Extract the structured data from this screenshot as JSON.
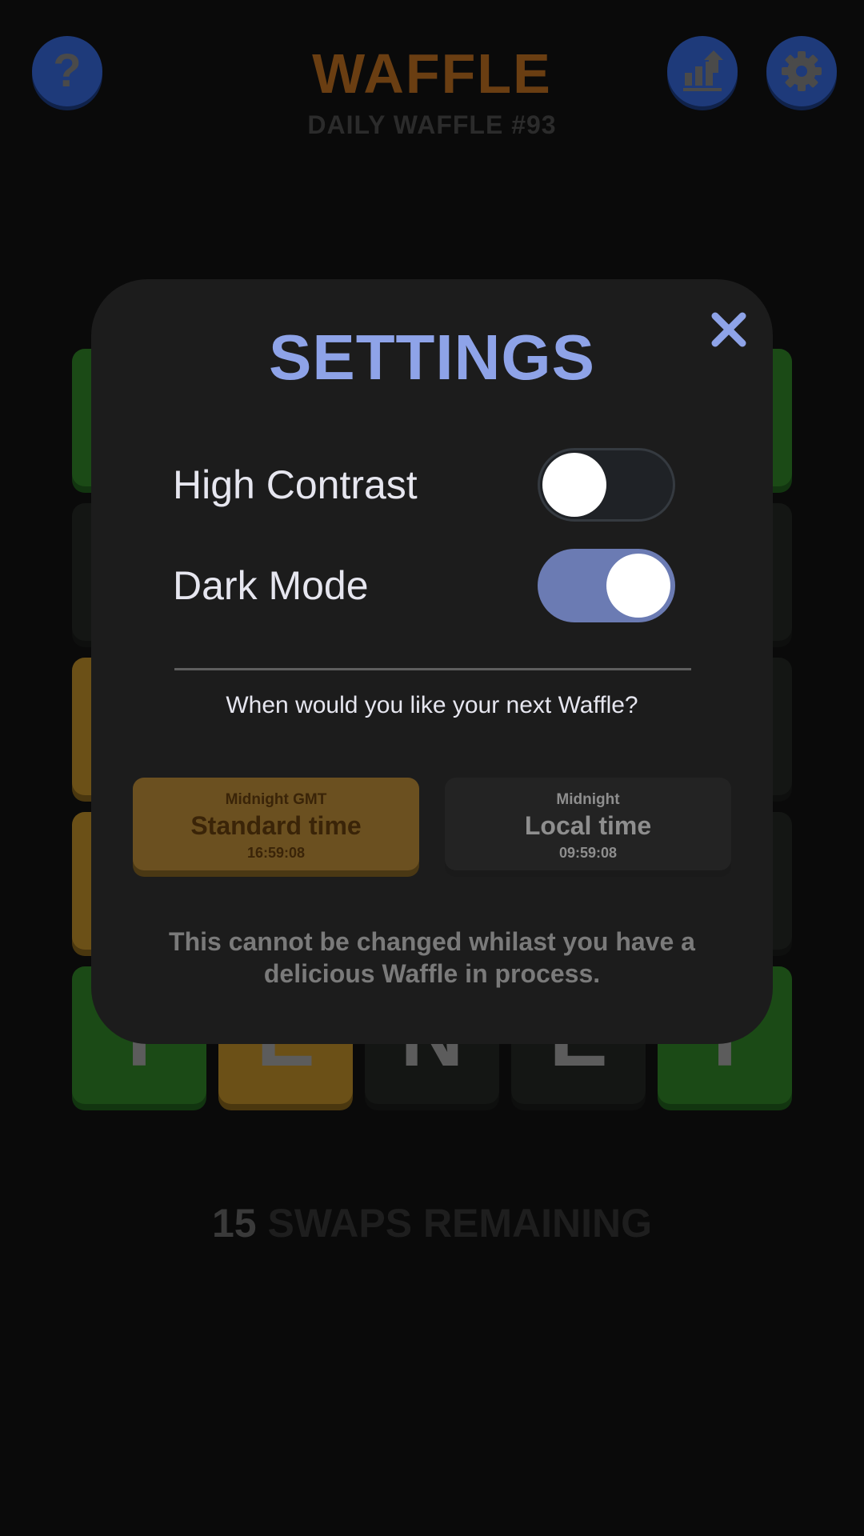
{
  "header": {
    "title": "WAFFLE",
    "subtitle": "DAILY WAFFLE #93",
    "help_glyph": "?",
    "icons": [
      "help-icon",
      "stats-icon",
      "gear-icon"
    ]
  },
  "board": {
    "tiles": [
      {
        "letter": "",
        "color": "green"
      },
      {
        "letter": "",
        "color": "green"
      },
      {
        "letter": "",
        "color": "gray"
      },
      {
        "letter": "",
        "color": "gray"
      },
      {
        "letter": "",
        "color": "yellow"
      },
      {
        "letter": "",
        "color": "gray"
      },
      {
        "letter": "",
        "color": "yellow"
      },
      {
        "letter": "",
        "color": "gray"
      },
      {
        "letter": "T",
        "color": "green"
      },
      {
        "letter": "E",
        "color": "yellow"
      },
      {
        "letter": "N",
        "color": "gray"
      },
      {
        "letter": "E",
        "color": "gray"
      },
      {
        "letter": "T",
        "color": "green"
      }
    ]
  },
  "footer": {
    "swaps_count": "15",
    "swaps_label": "SWAPS REMAINING"
  },
  "settings": {
    "title": "SETTINGS",
    "close_icon": "close-icon",
    "high_contrast": {
      "label": "High Contrast",
      "enabled": false
    },
    "dark_mode": {
      "label": "Dark Mode",
      "enabled": true
    },
    "next_question": "When would you like your next Waffle?",
    "standard": {
      "small": "Midnight GMT",
      "big": "Standard time",
      "clock": "16:59:08",
      "selected": true
    },
    "local": {
      "small": "Midnight",
      "big": "Local time",
      "clock": "09:59:08",
      "selected": false
    },
    "notice": "This cannot be changed whilast you have a delicious Waffle in process."
  },
  "colors": {
    "accent": "#8ea3e8",
    "toggle_on": "#6b7bb3",
    "standard_option": "#6b5020",
    "tile_green": "#1b4a16",
    "tile_yellow": "#6b5017",
    "tile_gray": "#141614"
  }
}
